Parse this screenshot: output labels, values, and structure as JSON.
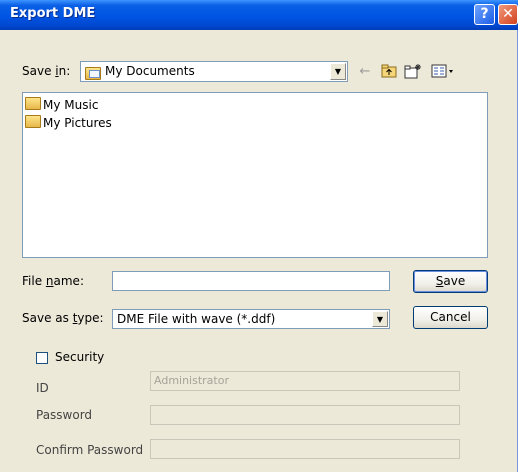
{
  "window": {
    "title": "Export DME",
    "help_glyph": "?",
    "close_glyph": "✕"
  },
  "toolbar": {
    "save_in_label_pre": "Save ",
    "save_in_label_ul": "i",
    "save_in_label_post": "n:",
    "location_value": "My Documents",
    "icons": [
      "back-arrow-icon",
      "up-folder-icon",
      "new-folder-icon",
      "view-menu-icon"
    ]
  },
  "file_list": {
    "items": [
      {
        "label": "My Music",
        "icon": "music-folder-icon"
      },
      {
        "label": "My Pictures",
        "icon": "pictures-folder-icon"
      }
    ]
  },
  "form": {
    "file_name_label_pre": "File ",
    "file_name_label_ul": "n",
    "file_name_label_post": "ame:",
    "file_name_value": "",
    "save_as_type_label_pre": "Save as ",
    "save_as_type_label_ul": "t",
    "save_as_type_label_post": "ype:",
    "save_as_type_value": "DME File with wave (*.ddf)",
    "save_button_ul": "S",
    "save_button_post": "ave",
    "cancel_button": "Cancel"
  },
  "security": {
    "checkbox_label": "Security",
    "checked": false,
    "id_label": "ID",
    "id_value": "Administrator",
    "password_label": "Password",
    "password_value": "",
    "confirm_label": "Confirm Password",
    "confirm_value": ""
  }
}
